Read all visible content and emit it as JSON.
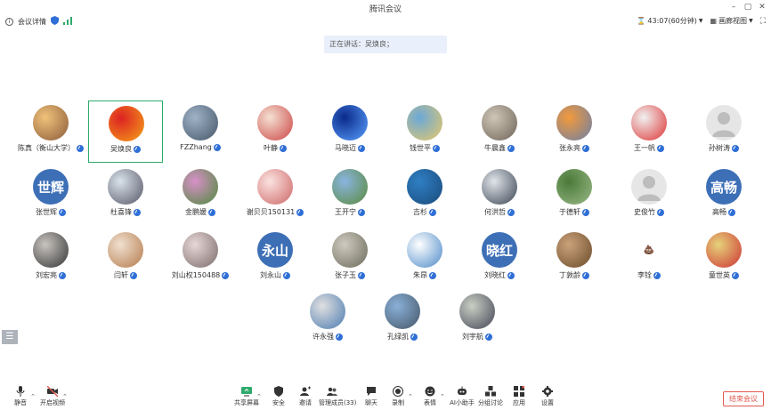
{
  "window": {
    "title": "腾讯会议"
  },
  "infobar": {
    "meeting_info_label": "会议详情",
    "timer": "43:07(60分钟)",
    "view_label": "画廊视图"
  },
  "speaking": {
    "text": "正在讲话：吴焕良；"
  },
  "participants": [
    {
      "name": "陈真（衡山大学）",
      "avatar": {
        "kind": "photo",
        "colors": [
          "#f0c27a",
          "#8a5a3a"
        ]
      }
    },
    {
      "name": "吴焕良",
      "avatar": {
        "kind": "photo",
        "colors": [
          "#d22",
          "#f5a31a"
        ]
      }
    },
    {
      "name": "FZZhang",
      "avatar": {
        "kind": "photo",
        "colors": [
          "#9fb3c8",
          "#445566"
        ]
      }
    },
    {
      "name": "叶静",
      "avatar": {
        "kind": "photo",
        "colors": [
          "#f4e1d2",
          "#c44"
        ]
      }
    },
    {
      "name": "马晓迈",
      "avatar": {
        "kind": "photo",
        "colors": [
          "#0a2a8a",
          "#5aa0ff"
        ]
      }
    },
    {
      "name": "钱世平",
      "avatar": {
        "kind": "photo",
        "colors": [
          "#6aa8d8",
          "#e8c96a"
        ]
      }
    },
    {
      "name": "牛晨鑫",
      "avatar": {
        "kind": "photo",
        "colors": [
          "#cfc6b8",
          "#6d6457"
        ]
      }
    },
    {
      "name": "张永亮",
      "avatar": {
        "kind": "photo",
        "colors": [
          "#f39a3b",
          "#6b7fa8"
        ]
      }
    },
    {
      "name": "王一帆",
      "avatar": {
        "kind": "photo",
        "colors": [
          "#f1f1f1",
          "#d33"
        ]
      }
    },
    {
      "name": "孙树涛",
      "avatar": {
        "kind": "default",
        "colors": [
          "#e6e6e6",
          "#bdbdbd"
        ]
      }
    },
    {
      "name": "张世辉",
      "avatar": {
        "kind": "text",
        "text": "世辉",
        "colors": [
          "#3d6fb6",
          "#3d6fb6"
        ]
      }
    },
    {
      "name": "杜喜锋",
      "avatar": {
        "kind": "photo",
        "colors": [
          "#d9e3ea",
          "#556"
        ]
      }
    },
    {
      "name": "金鹏媛",
      "avatar": {
        "kind": "photo",
        "colors": [
          "#d890c8",
          "#4c8a3a"
        ]
      }
    },
    {
      "name": "谢贝贝150131",
      "avatar": {
        "kind": "photo",
        "colors": [
          "#fbe3e0",
          "#c66"
        ]
      }
    },
    {
      "name": "王开宁",
      "avatar": {
        "kind": "photo",
        "colors": [
          "#8ab4e0",
          "#5a8a3a"
        ]
      }
    },
    {
      "name": "吉杉",
      "avatar": {
        "kind": "photo",
        "colors": [
          "#2f7fc4",
          "#1a4a7a"
        ]
      }
    },
    {
      "name": "何洪哲",
      "avatar": {
        "kind": "photo",
        "colors": [
          "#e0e4ea",
          "#3a4452"
        ]
      }
    },
    {
      "name": "于德轩",
      "avatar": {
        "kind": "photo",
        "colors": [
          "#4a7a3a",
          "#9ab886"
        ]
      }
    },
    {
      "name": "史俊竹",
      "avatar": {
        "kind": "default",
        "colors": [
          "#e6e6e6",
          "#bdbdbd"
        ]
      }
    },
    {
      "name": "高畅",
      "avatar": {
        "kind": "text",
        "text": "高畅",
        "colors": [
          "#3d6fb6",
          "#3d6fb6"
        ]
      }
    },
    {
      "name": "刘宏亮",
      "avatar": {
        "kind": "photo",
        "colors": [
          "#c8c4c0",
          "#333"
        ]
      }
    },
    {
      "name": "闫轩",
      "avatar": {
        "kind": "photo",
        "colors": [
          "#f0e0d0",
          "#b47a4a"
        ]
      }
    },
    {
      "name": "刘山权150488",
      "avatar": {
        "kind": "photo",
        "colors": [
          "#e7d7d7",
          "#7a6a6a"
        ]
      }
    },
    {
      "name": "刘永山",
      "avatar": {
        "kind": "text",
        "text": "永山",
        "colors": [
          "#3d6fb6",
          "#3d6fb6"
        ]
      }
    },
    {
      "name": "张子玉",
      "avatar": {
        "kind": "photo",
        "colors": [
          "#cfcac0",
          "#6a6a5a"
        ]
      }
    },
    {
      "name": "朱昂",
      "avatar": {
        "kind": "photo",
        "colors": [
          "#ffffff",
          "#4c8ac8"
        ]
      }
    },
    {
      "name": "刘晓红",
      "avatar": {
        "kind": "text",
        "text": "晓红",
        "colors": [
          "#3d6fb6",
          "#3d6fb6"
        ]
      }
    },
    {
      "name": "丁敦龄",
      "avatar": {
        "kind": "photo",
        "colors": [
          "#caa27a",
          "#6a4a2a"
        ]
      }
    },
    {
      "name": "李铨",
      "avatar": {
        "kind": "poop",
        "colors": [
          "#ffffff",
          "#8a4a1a"
        ]
      }
    },
    {
      "name": "童世英",
      "avatar": {
        "kind": "photo",
        "colors": [
          "#e6d27a",
          "#c33"
        ]
      }
    },
    {
      "name": "许永强",
      "avatar": {
        "kind": "photo",
        "colors": [
          "#e0e0e0",
          "#4a7ab0"
        ]
      }
    },
    {
      "name": "孔绿凯",
      "avatar": {
        "kind": "photo",
        "colors": [
          "#8ab0d8",
          "#445566"
        ]
      }
    },
    {
      "name": "刘宇航",
      "avatar": {
        "kind": "photo",
        "colors": [
          "#c9cfc4",
          "#445"
        ]
      }
    }
  ],
  "active_participant_index": 1,
  "side_handle": {
    "icon": "list-icon"
  },
  "toolbar": {
    "items": [
      {
        "key": "mute",
        "label": "静音",
        "icon": "microphone-icon",
        "has_menu": true
      },
      {
        "key": "video",
        "label": "开启视频",
        "icon": "camera-off-icon",
        "has_menu": true
      },
      {
        "key": "share",
        "label": "共享屏幕",
        "icon": "screen-share-icon",
        "has_menu": true
      },
      {
        "key": "security",
        "label": "安全",
        "icon": "shield-icon",
        "has_menu": false
      },
      {
        "key": "invite",
        "label": "邀请",
        "icon": "add-user-icon",
        "has_menu": false
      },
      {
        "key": "members",
        "label": "管理成员(33)",
        "icon": "users-icon",
        "has_menu": false
      },
      {
        "key": "chat",
        "label": "聊天",
        "icon": "chat-icon",
        "has_menu": false
      },
      {
        "key": "record",
        "label": "录制",
        "icon": "record-icon",
        "has_menu": true
      },
      {
        "key": "reaction",
        "label": "表情",
        "icon": "emoji-icon",
        "has_menu": true
      },
      {
        "key": "ai",
        "label": "AI小助手",
        "icon": "ai-assistant-icon",
        "has_menu": false
      },
      {
        "key": "breakout",
        "label": "分组讨论",
        "icon": "group-icon",
        "has_menu": false
      },
      {
        "key": "apps",
        "label": "应用",
        "icon": "apps-icon",
        "has_menu": false
      },
      {
        "key": "settings",
        "label": "设置",
        "icon": "gear-icon",
        "has_menu": false
      }
    ],
    "end_label": "结束会议"
  },
  "colors": {
    "accent": "#2f6fd6",
    "active_border": "#2eaa6c",
    "end_button": "#e05a4f",
    "text_avatar": "#3d6fb6"
  }
}
